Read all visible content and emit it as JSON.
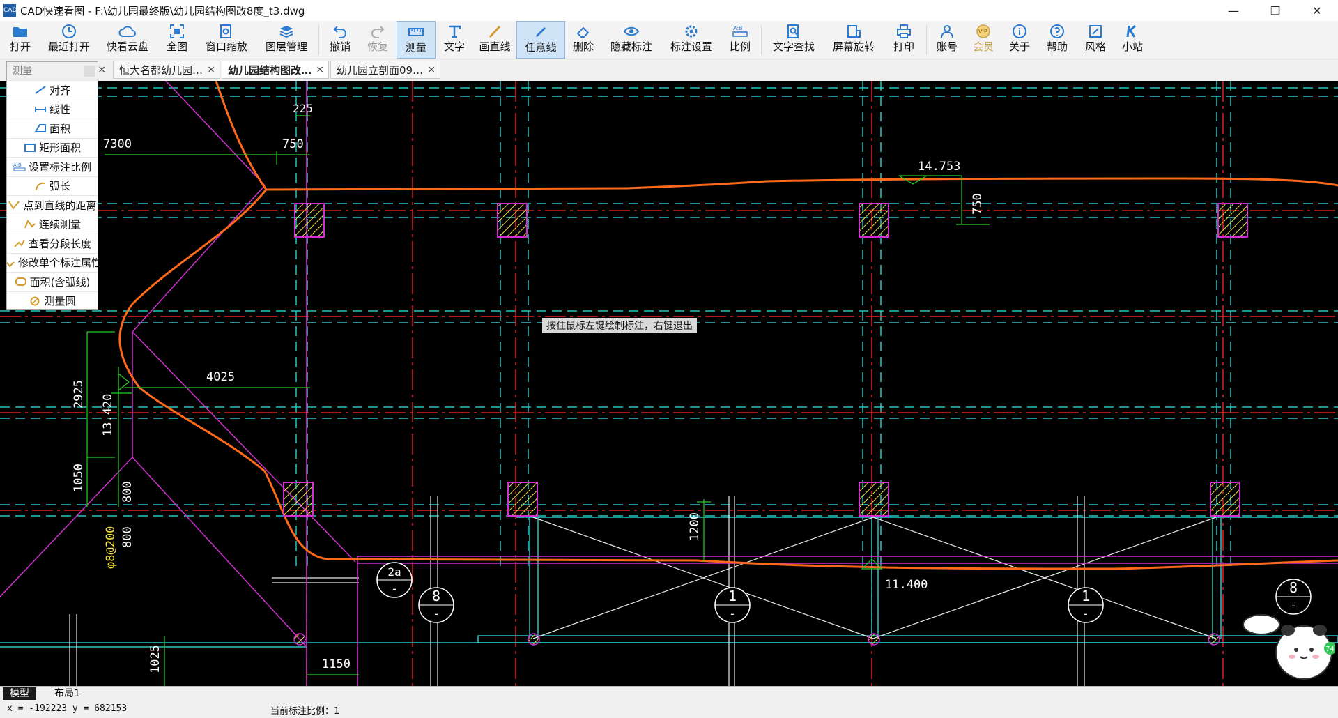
{
  "window": {
    "app_icon_text": "CAD",
    "title": "CAD快速看图 - F:\\幼儿园最终版\\幼儿园结构图改8度_t3.dwg",
    "minimize": "—",
    "maximize": "❐",
    "close": "✕"
  },
  "toolbar": {
    "open": "打开",
    "recent": "最近打开",
    "cloud": "快看云盘",
    "full_view": "全图",
    "window_zoom": "窗口缩放",
    "layer_mgmt": "图层管理",
    "undo": "撤销",
    "redo": "恢复",
    "measure": "测量",
    "text": "文字",
    "draw_line": "画直线",
    "any_line": "任意线",
    "delete": "删除",
    "hide_dim": "隐藏标注",
    "dim_settings": "标注设置",
    "scale": "比例",
    "text_search": "文字查找",
    "screen_rotate": "屏幕旋转",
    "print": "打印",
    "account": "账号",
    "member": "会员",
    "about": "关于",
    "help": "帮助",
    "style": "风格",
    "site": "小站"
  },
  "tabs": [
    {
      "label": "恒大名都幼儿园…",
      "close": "×"
    },
    {
      "label": "幼儿园结构图改…",
      "close": "×"
    },
    {
      "label": "幼儿园立剖面09…",
      "close": "×"
    }
  ],
  "first_tab_close": "×",
  "measure_menu": {
    "header": "测量",
    "items": [
      "对齐",
      "线性",
      "面积",
      "矩形面积",
      "设置标注比例",
      "弧长",
      "点到直线的距离",
      "连续测量",
      "查看分段长度",
      "修改单个标注属性",
      "面积(含弧线)",
      "测量圆"
    ]
  },
  "canvas": {
    "hint": "按住鼠标左键绘制标注，右键退出",
    "dims": {
      "d225": "225",
      "d7300": "7300",
      "d750a": "750",
      "d14753": "14.753",
      "d750b": "750",
      "d4025": "4025",
      "d2925": "2925",
      "d13420": "13.420",
      "d1050": "1050",
      "d800a": "800",
      "d800b": "800",
      "rebar": "φ8@200",
      "d1200": "1200",
      "d11400": "11.400",
      "d1025": "1025",
      "d1150": "1150"
    },
    "bubbles": [
      "2a",
      "8",
      "1",
      "1",
      "8"
    ],
    "bubble_sub": "-"
  },
  "layout_tabs": [
    "模型",
    "布局1"
  ],
  "status": {
    "coords": "x = -192223 y = 682153",
    "scale": "当前标注比例：1"
  },
  "mascot": {
    "badge": "74"
  }
}
